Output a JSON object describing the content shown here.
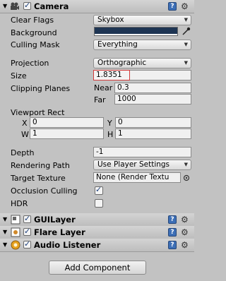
{
  "camera": {
    "title": "Camera",
    "clear_flags": {
      "label": "Clear Flags",
      "value": "Skybox"
    },
    "background": {
      "label": "Background",
      "color": "#1e3553"
    },
    "culling_mask": {
      "label": "Culling Mask",
      "value": "Everything"
    },
    "projection": {
      "label": "Projection",
      "value": "Orthographic"
    },
    "size": {
      "label": "Size",
      "value": "1.8351"
    },
    "clipping_planes": {
      "label": "Clipping Planes",
      "near_label": "Near",
      "near": "0.3",
      "far_label": "Far",
      "far": "1000"
    },
    "viewport_rect": {
      "label": "Viewport Rect",
      "x_label": "X",
      "x": "0",
      "y_label": "Y",
      "y": "0",
      "w_label": "W",
      "w": "1",
      "h_label": "H",
      "h": "1"
    },
    "depth": {
      "label": "Depth",
      "value": "-1"
    },
    "rendering_path": {
      "label": "Rendering Path",
      "value": "Use Player Settings"
    },
    "target_texture": {
      "label": "Target Texture",
      "value": "None (Render Textu"
    },
    "occlusion_culling": {
      "label": "Occlusion Culling",
      "checked": true
    },
    "hdr": {
      "label": "HDR",
      "checked": false
    }
  },
  "components": [
    {
      "title": "GUILayer",
      "icon": "guilayer-icon"
    },
    {
      "title": "Flare Layer",
      "icon": "flare-layer-icon"
    },
    {
      "title": "Audio Listener",
      "icon": "audio-listener-icon"
    }
  ],
  "add_component_label": "Add Component",
  "icons": {
    "help": "?",
    "gear": "⚙",
    "foldout": "▼",
    "check": "✓",
    "popup_arrow": "▼",
    "picker": "object-picker-icon"
  },
  "colors": {
    "size_highlight": "#d23b3b",
    "help_blue": "#3d6fb6"
  }
}
